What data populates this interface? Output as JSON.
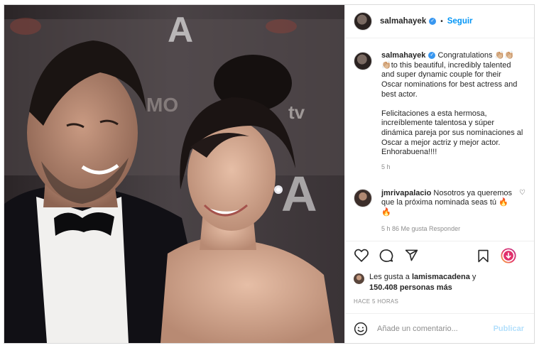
{
  "post": {
    "author": "salmahayek",
    "header_separator": "•",
    "follow_label": "Seguir"
  },
  "caption": {
    "username": "salmahayek",
    "text_en": " Congratulations 👏🏼👏🏼👏🏼to this beautiful, incredibly talented and super dynamic couple for their Oscar nominations for best actress and best actor.",
    "text_es": "Felicitaciones a esta hermosa, increíblemente talentosa y súper dinámica pareja por sus nominaciones al Oscar a mejor actriz y mejor actor. Enhorabuena!!!!",
    "time": "5 h"
  },
  "reply": {
    "username": "jmrivapalacio",
    "text": " Nosotros ya queremos que la próxima nominada seas tú 🔥🔥",
    "meta": "5 h    86 Me gusta    Responder"
  },
  "likes": {
    "prefix": "Les gusta a ",
    "user": "lamismacadena",
    "middle": " y ",
    "count": "150.408 personas más"
  },
  "timestamp": "HACE 5 HORAS",
  "comment_box": {
    "placeholder": "Añade un comentario...",
    "publish_label": "Publicar"
  },
  "icons": [
    "verified-icon",
    "heart-icon",
    "comment-icon",
    "share-icon",
    "save-icon",
    "story-icon",
    "emoji-icon",
    "small-heart-icon"
  ],
  "colors": {
    "accent": "#0095f6",
    "publish_disabled": "#b2dffc",
    "verified": "#3897f0",
    "muted": "#8e8e8e"
  }
}
